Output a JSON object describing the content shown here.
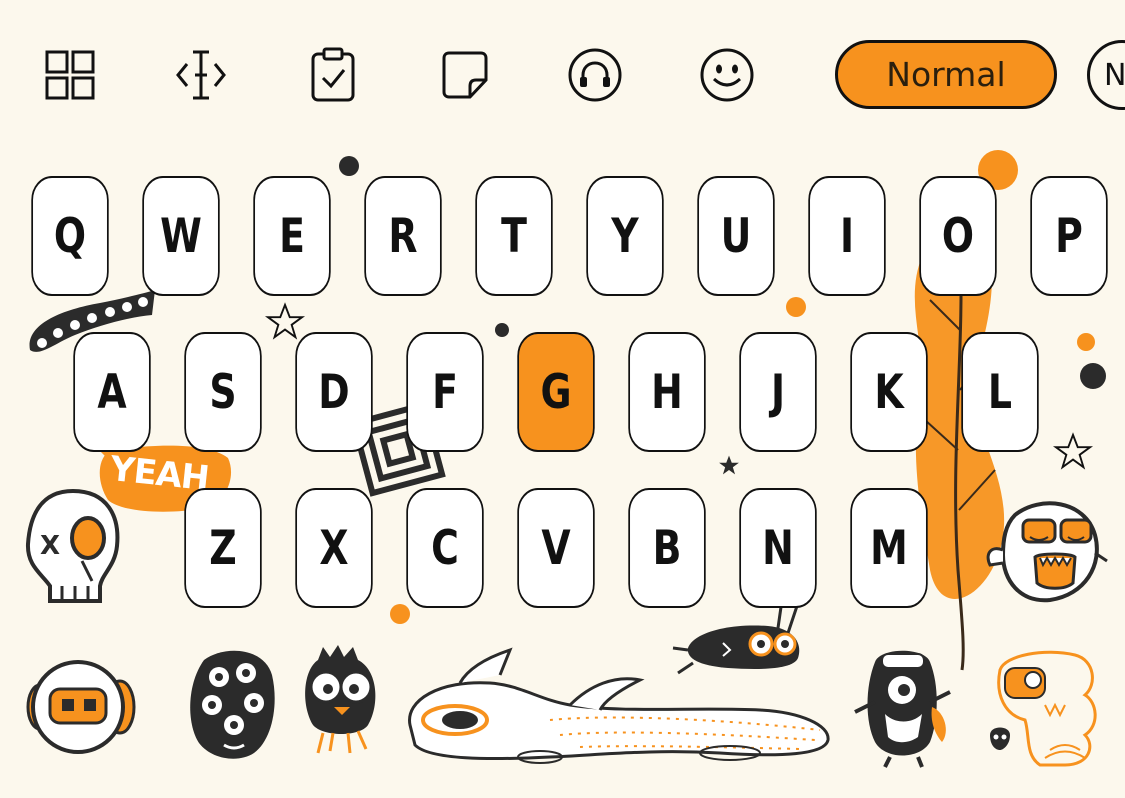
{
  "toolbar": {
    "items": [
      {
        "name": "grid-icon"
      },
      {
        "name": "text-cursor-icon"
      },
      {
        "name": "clipboard-icon"
      },
      {
        "name": "sticker-icon"
      },
      {
        "name": "headphones-icon"
      },
      {
        "name": "smiley-icon"
      }
    ],
    "mode_label": "Normal",
    "mode_next_label": "N"
  },
  "keyboard": {
    "row1": [
      "Q",
      "W",
      "E",
      "R",
      "T",
      "Y",
      "U",
      "I",
      "O",
      "P"
    ],
    "row2": [
      "A",
      "S",
      "D",
      "F",
      "G",
      "H",
      "J",
      "K",
      "L"
    ],
    "row3": [
      "Z",
      "X",
      "C",
      "V",
      "B",
      "N",
      "M"
    ],
    "active_key": "G"
  },
  "stickers": {
    "yeah_text": "YEAH"
  },
  "colors": {
    "background": "#fcf8ed",
    "accent": "#f7921e",
    "ink": "#111111",
    "key_fill": "#ffffff"
  }
}
